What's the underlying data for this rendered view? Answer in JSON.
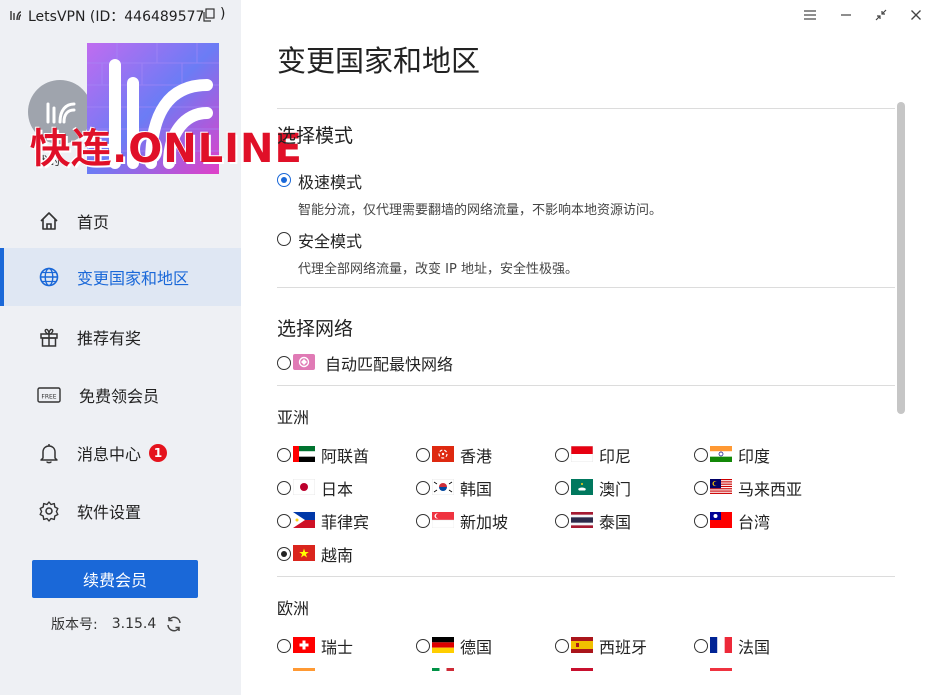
{
  "window": {
    "title": "LetsVPN (ID：446489577",
    "title_suffix": ")"
  },
  "sidebar": {
    "user_name": "我的",
    "promo_text": "快连.ONLINE",
    "nav": [
      {
        "label": "首页",
        "icon": "home-icon"
      },
      {
        "label": "变更国家和地区",
        "icon": "globe-icon",
        "active": true
      },
      {
        "label": "推荐有奖",
        "icon": "gift-icon"
      },
      {
        "label": "免费领会员",
        "icon": "free-ticket-icon"
      },
      {
        "label": "消息中心",
        "icon": "bell-icon",
        "badge": "1"
      },
      {
        "label": "软件设置",
        "icon": "gear-icon"
      }
    ],
    "renew_label": "续费会员",
    "version_label": "版本号:",
    "version_value": "3.15.4"
  },
  "main": {
    "title": "变更国家和地区",
    "mode_section": {
      "title": "选择模式",
      "options": [
        {
          "label": "极速模式",
          "desc": "智能分流，仅代理需要翻墙的网络流量，不影响本地资源访问。",
          "checked": true
        },
        {
          "label": "安全模式",
          "desc": "代理全部网络流量，改变 IP 地址，安全性极强。",
          "checked": false
        }
      ]
    },
    "network_section": {
      "title": "选择网络",
      "auto_label": "自动匹配最快网络"
    },
    "regions": [
      {
        "title": "亚洲",
        "countries": [
          {
            "label": "阿联酋",
            "flag": "uae"
          },
          {
            "label": "香港",
            "flag": "hk"
          },
          {
            "label": "印尼",
            "flag": "id"
          },
          {
            "label": "印度",
            "flag": "in"
          },
          {
            "label": "日本",
            "flag": "jp"
          },
          {
            "label": "韩国",
            "flag": "kr"
          },
          {
            "label": "澳门",
            "flag": "mo"
          },
          {
            "label": "马来西亚",
            "flag": "my"
          },
          {
            "label": "菲律宾",
            "flag": "ph"
          },
          {
            "label": "新加坡",
            "flag": "sg"
          },
          {
            "label": "泰国",
            "flag": "th"
          },
          {
            "label": "台湾",
            "flag": "tw"
          },
          {
            "label": "越南",
            "flag": "vn",
            "checked": true
          }
        ]
      },
      {
        "title": "欧洲",
        "countries": [
          {
            "label": "瑞士",
            "flag": "ch"
          },
          {
            "label": "德国",
            "flag": "de"
          },
          {
            "label": "西班牙",
            "flag": "es"
          },
          {
            "label": "法国",
            "flag": "fr"
          }
        ]
      }
    ]
  },
  "colors": {
    "accent": "#1a68d8",
    "sidebar_bg": "#eef0f4",
    "active_bg": "#dfe7f3",
    "badge": "#e5131d",
    "promo_text": "#e01028"
  }
}
